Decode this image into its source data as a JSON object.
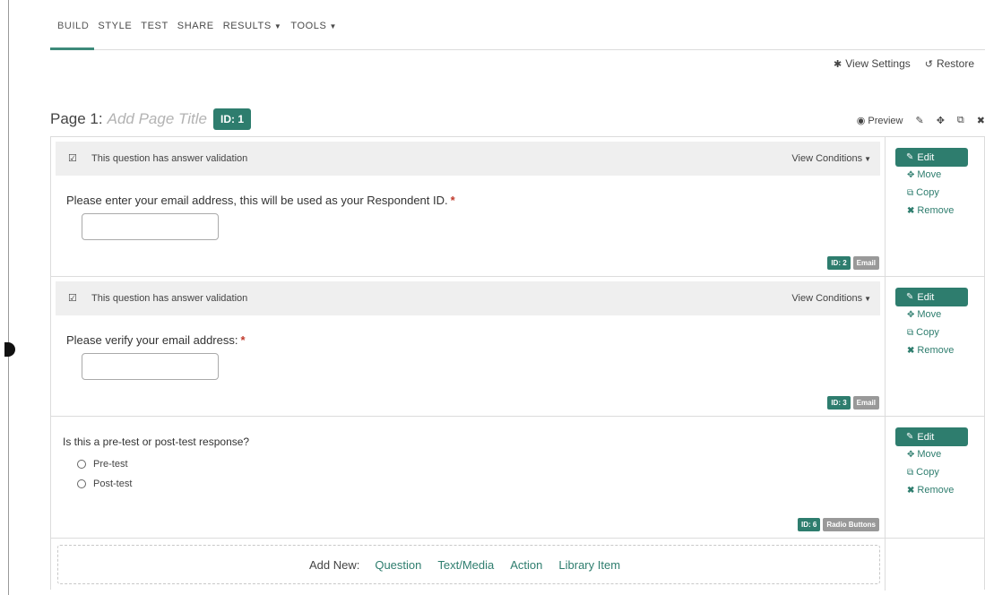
{
  "nav": {
    "tabs": [
      {
        "label": "BUILD",
        "dropdown": false
      },
      {
        "label": "STYLE",
        "dropdown": false
      },
      {
        "label": "TEST",
        "dropdown": false
      },
      {
        "label": "SHARE",
        "dropdown": false
      },
      {
        "label": "RESULTS",
        "dropdown": true
      },
      {
        "label": "TOOLS",
        "dropdown": true
      }
    ],
    "active_tab": "BUILD"
  },
  "top_actions": {
    "view_settings": "View Settings",
    "restore": "Restore"
  },
  "page": {
    "prefix": "Page 1:",
    "title_placeholder": "Add Page Title",
    "id_label": "ID: 1",
    "preview": "Preview"
  },
  "questions": [
    {
      "validation_text": "This question has answer validation",
      "view_conditions": "View Conditions",
      "text": "Please enter your email address, this will be used as your Respondent ID.",
      "required_mark": "*",
      "id_badge": "ID: 2",
      "type_badge": "Email"
    },
    {
      "validation_text": "This question has answer validation",
      "view_conditions": "View Conditions",
      "text": "Please verify your email address:",
      "required_mark": "*",
      "id_badge": "ID: 3",
      "type_badge": "Email"
    },
    {
      "text": "Is this a pre-test or post-test response?",
      "options": [
        "Pre-test",
        "Post-test"
      ],
      "id_badge": "ID: 6",
      "type_badge": "Radio Buttons"
    }
  ],
  "side_actions": {
    "edit": "Edit",
    "move": "Move",
    "copy": "Copy",
    "remove": "Remove"
  },
  "add_new": {
    "label": "Add New:",
    "links": [
      "Question",
      "Text/Media",
      "Action",
      "Library Item"
    ]
  },
  "colors": {
    "accent": "#2e7d6e",
    "badge_gray": "#999999",
    "required": "#c0392b"
  }
}
